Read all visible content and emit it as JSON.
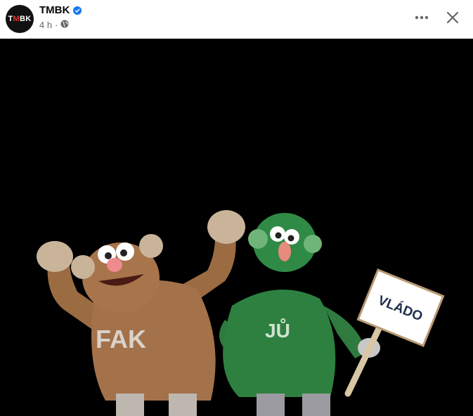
{
  "post": {
    "page_name": "TMBK",
    "avatar_text": "TMBK",
    "verified": true,
    "time": "4 h",
    "separator": "·",
    "audience_icon": "globe-icon"
  },
  "actions": {
    "more_icon": "more-options-icon",
    "close_icon": "close-icon"
  },
  "image": {
    "left_puppet_label": "FAK",
    "right_puppet_label": "JŮ",
    "sign_text": "VLÁDO"
  }
}
